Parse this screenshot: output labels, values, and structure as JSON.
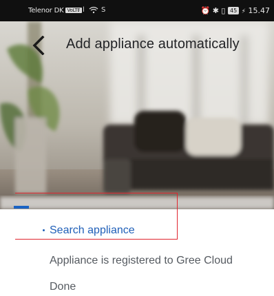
{
  "status_bar": {
    "carrier": "Telenor DK",
    "carrier_badge": "VoLTE",
    "signal_text": ".ıl",
    "wifi_text": "S",
    "right_icons": "⏰ ✱ ▯",
    "battery": "45",
    "time": "15.47"
  },
  "header": {
    "title": "Add appliance automatically",
    "back_icon": "chevron-left-icon"
  },
  "steps": [
    {
      "label": "Search appliance",
      "state": "active"
    },
    {
      "label": "Appliance is registered to Gree Cloud",
      "state": "pending"
    },
    {
      "label": "Done",
      "state": "pending"
    }
  ],
  "colors": {
    "accent": "#1f5fb8",
    "highlight": "#e0242d",
    "status_bar": "#101010"
  }
}
